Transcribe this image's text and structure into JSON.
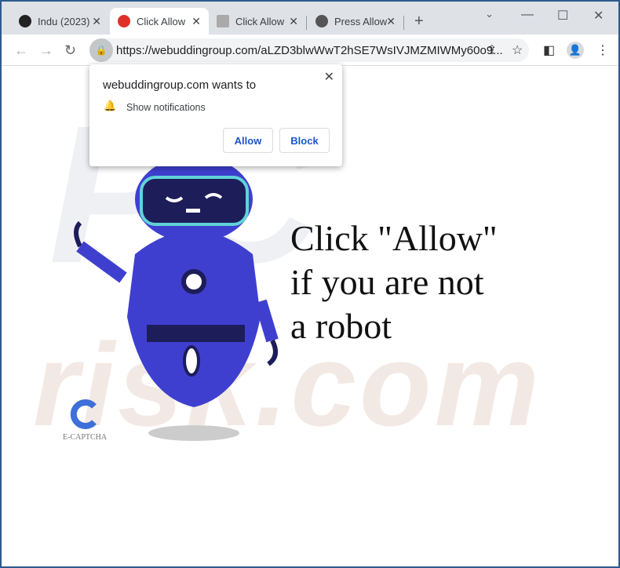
{
  "tabs": [
    {
      "title": "Indu (2023)",
      "icon": "film-reel-icon",
      "active": false
    },
    {
      "title": "Click Allow",
      "icon": "red-circle-icon",
      "active": true
    },
    {
      "title": "Click Allow",
      "icon": "robot-thumbnail-icon",
      "active": false
    },
    {
      "title": "Press Allow",
      "icon": "globe-icon",
      "active": false
    }
  ],
  "address_bar": {
    "url": "https://webuddingroup.com/aLZD3blwWwT2hSE7WsIVJMZMIWMy60o9..."
  },
  "permission_popup": {
    "title": "webuddingroup.com wants to",
    "permission": "Show notifications",
    "allow_label": "Allow",
    "block_label": "Block"
  },
  "page": {
    "headline_lines": [
      "Click \"Allow\"",
      "if you are not",
      "a robot"
    ],
    "captcha_label": "E-CAPTCHA",
    "watermark": "risk.com"
  },
  "colors": {
    "window_border": "#2c5a8f",
    "robot": "#3f3fcf",
    "button_text": "#1a56c9"
  }
}
